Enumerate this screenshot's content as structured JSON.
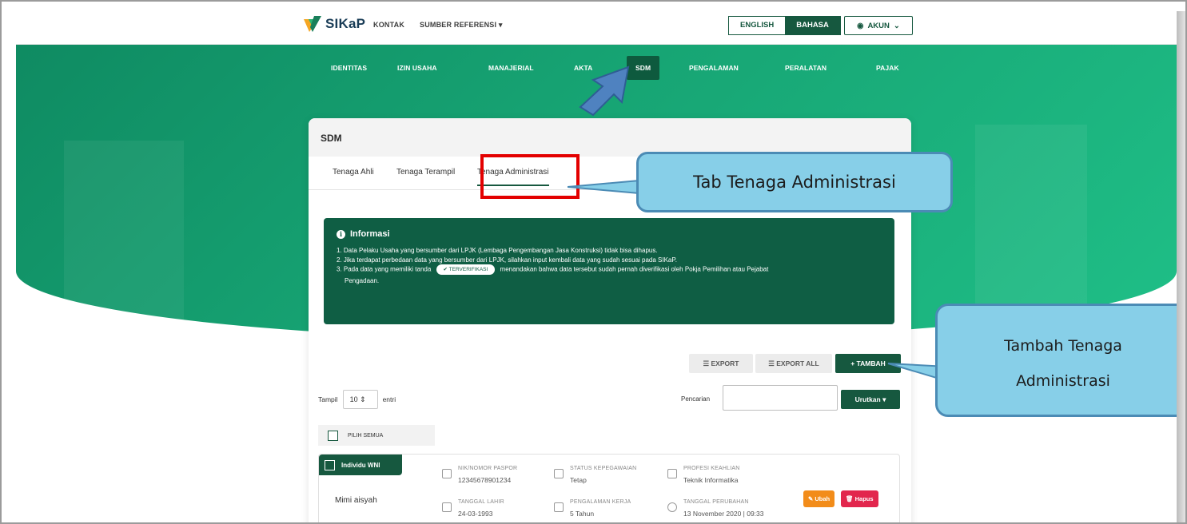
{
  "topbar": {
    "logo_text": "SIKaP",
    "links": [
      "KONTAK",
      "SUMBER REFERENSI"
    ],
    "lang_english": "ENGLISH",
    "lang_bahasa": "BAHASA",
    "account_label": "AKUN"
  },
  "menu": [
    "IDENTITAS",
    "IZIN USAHA",
    "MANAJERIAL",
    "AKTA",
    "SDM",
    "PENGALAMAN",
    "PERALATAN",
    "PAJAK"
  ],
  "card": {
    "title": "SDM",
    "tabs": [
      "Tenaga Ahli",
      "Tenaga Terampil",
      "Tenaga Administrasi"
    ],
    "info": {
      "title": "Informasi",
      "line1": "1. Data Pelaku Usaha yang bersumber dari LPJK (Lembaga Pengembangan Jasa Konstruksi) tidak bisa dihapus.",
      "line2": "2. Jika terdapat perbedaan data yang bersumber dari LPJK, silahkan input kembali data yang sudah sesuai pada SIKaP.",
      "line3_a": "3. Pada data yang memiliki tanda",
      "badge": "✔ TERVERIFIKASI",
      "line3_b": "menandakan bahwa data tersebut sudah pernah diverifikasi oleh Pokja Pemilihan atau Pejabat",
      "line3_c": "Pengadaan."
    },
    "buttons": {
      "export": "EXPORT",
      "export_all": "EXPORT ALL",
      "tambah": "+ TAMBAH",
      "urutkan": "Urutkan"
    },
    "tampil_label": "Tampil",
    "tampil_value": "10",
    "entri_label": "entri",
    "search_label": "Pencarian",
    "search_value": "",
    "pilih_semua": "PILIH SEMUA"
  },
  "row": {
    "tag": "Individu WNI",
    "name": "Mimi aisyah",
    "fields": [
      {
        "label": "NIK/NOMOR PASPOR",
        "value": "12345678901234"
      },
      {
        "label": "STATUS KEPEGAWAIAN",
        "value": "Tetap"
      },
      {
        "label": "PROFESI KEAHLIAN",
        "value": "Teknik Informatika"
      },
      {
        "label": "TANGGAL LAHIR",
        "value": "24-03-1993"
      },
      {
        "label": "PENGALAMAN KERJA",
        "value": "5 Tahun"
      },
      {
        "label": "TANGGAL PERUBAHAN",
        "value": "13 November 2020 | 09:33"
      }
    ],
    "edit_label": "Ubah",
    "delete_label": "Hapus"
  },
  "annotations": {
    "tab_callout": "Tab Tenaga Administrasi",
    "tambah_callout_line1": "Tambah Tenaga",
    "tambah_callout_line2": "Administrasi"
  },
  "colors": {
    "brand_green": "#16583f",
    "hero_green": "#17a574",
    "callout_blue": "#87cfe8",
    "highlight_red": "#e30000",
    "edit_orange": "#f28c1a",
    "delete_red": "#e2264d"
  }
}
